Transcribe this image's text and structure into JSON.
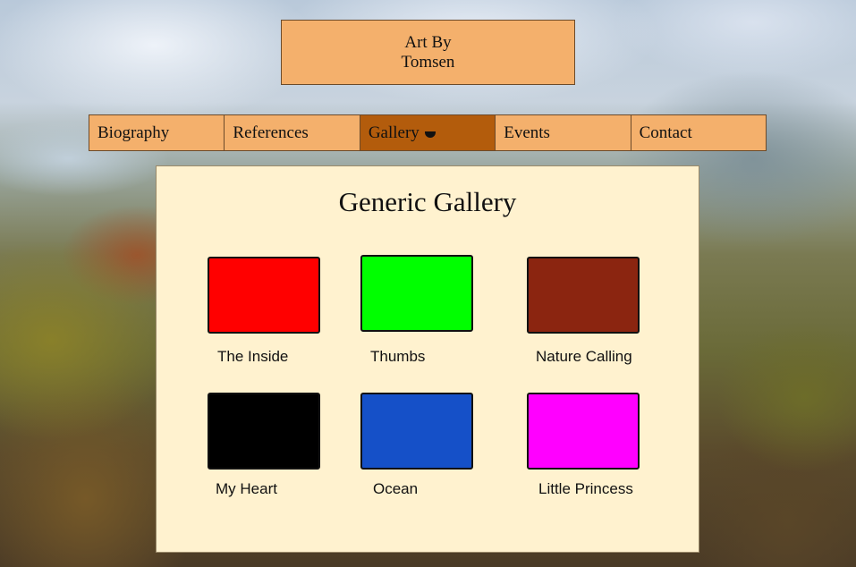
{
  "header": {
    "line1": "Art By",
    "line2": "Tomsen",
    "bg_color": "#f4b06c"
  },
  "nav": {
    "items": [
      {
        "label": "Biography"
      },
      {
        "label": "References"
      },
      {
        "label": "Gallery",
        "active": true,
        "icon": "caret-down-icon"
      },
      {
        "label": "Events"
      },
      {
        "label": "Contact"
      }
    ],
    "active_color": "#b35c0c"
  },
  "gallery": {
    "title": "Generic Gallery",
    "items": [
      {
        "caption": "The Inside",
        "color": "#ff0000"
      },
      {
        "caption": "Thumbs",
        "color": "#00ff00"
      },
      {
        "caption": "Nature Calling",
        "color": "#8b2510"
      },
      {
        "caption": "My Heart",
        "color": "#000000"
      },
      {
        "caption": "Ocean",
        "color": "#1550c8"
      },
      {
        "caption": "Little Princess",
        "color": "#ff00ff"
      }
    ]
  }
}
